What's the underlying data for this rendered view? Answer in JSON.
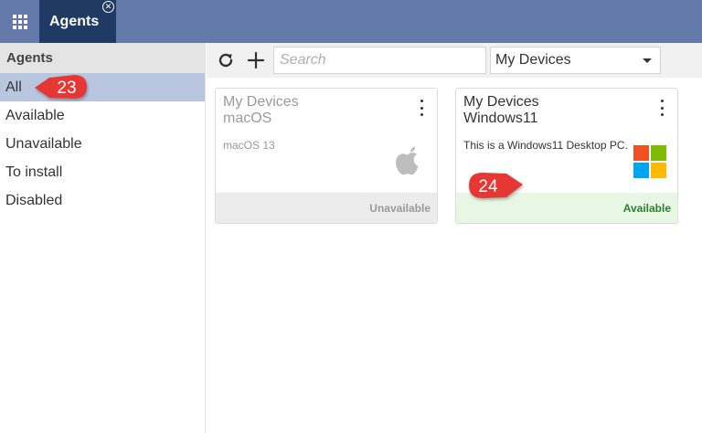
{
  "topbar": {
    "apps_icon": "grid-icon",
    "tab": {
      "label": "Agents",
      "close_icon": "close-circle-icon"
    }
  },
  "sidebar": {
    "header": "Agents",
    "items": [
      {
        "label": "All",
        "active": true
      },
      {
        "label": "Available",
        "active": false
      },
      {
        "label": "Unavailable",
        "active": false
      },
      {
        "label": "To install",
        "active": false
      },
      {
        "label": "Disabled",
        "active": false
      }
    ]
  },
  "toolbar": {
    "refresh_icon": "refresh-icon",
    "add_icon": "plus-icon",
    "search": {
      "placeholder": "Search",
      "value": ""
    },
    "filter": {
      "selected": "My Devices",
      "caret_icon": "caret-down-icon"
    }
  },
  "cards": [
    {
      "group": "My Devices",
      "name": "macOS",
      "description": "macOS 13",
      "status": "Unavailable",
      "logo": "apple-logo-icon"
    },
    {
      "group": "My Devices",
      "name": "Windows11",
      "description": "This is a Windows11 Desktop PC.",
      "status": "Available",
      "logo": "windows-logo-icon"
    }
  ],
  "callouts": [
    {
      "number": "23"
    },
    {
      "number": "24"
    }
  ],
  "colors": {
    "topbar": "#6479aa",
    "active_tab": "#1f3b63",
    "sidebar_active": "#b9c6e0",
    "available_bg": "#e8f6e4",
    "available_text": "#2f7d32",
    "unavailable_bg": "#ececec",
    "callout": "#e53935",
    "win_red": "#f25022",
    "win_green": "#7fba00",
    "win_blue": "#00a4ef",
    "win_yellow": "#ffb900"
  }
}
